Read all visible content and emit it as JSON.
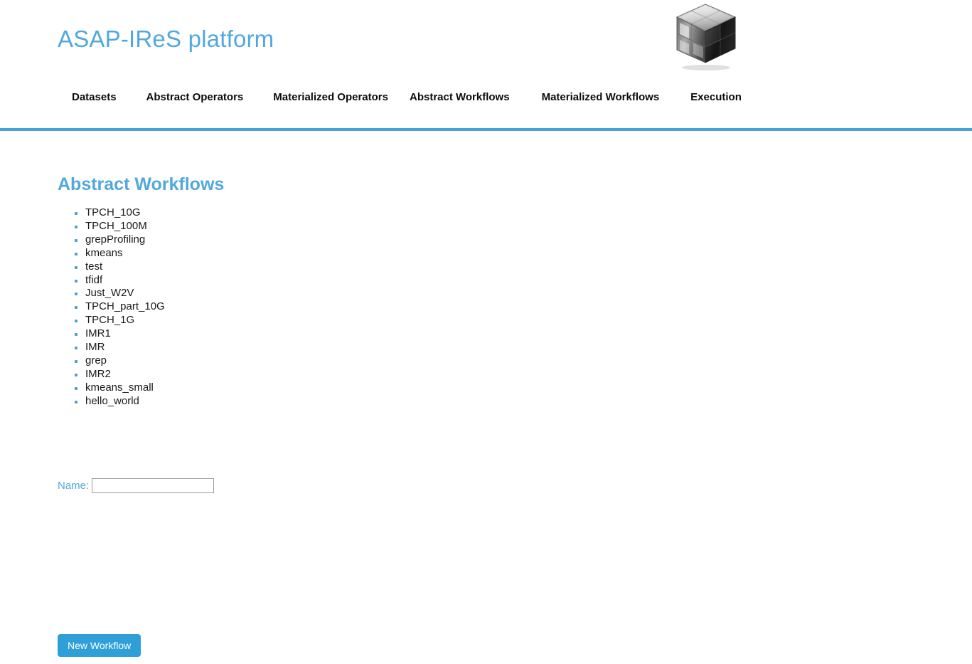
{
  "header": {
    "brand_title": "ASAP-IReS platform",
    "logo_icon": "cube-logo-icon",
    "accent_color": "#52a8dd",
    "rule_color": "#44a3db"
  },
  "nav": {
    "items": [
      {
        "label": "Datasets",
        "name": "nav-item-datasets"
      },
      {
        "label": "Abstract Operators",
        "name": "nav-item-abstract-operators"
      },
      {
        "label": "Materialized Operators",
        "name": "nav-item-materialized-operators"
      },
      {
        "label": "Abstract Workflows",
        "name": "nav-item-abstract-workflows"
      },
      {
        "label": "Materialized Workflows",
        "name": "nav-item-materialized-workflows"
      },
      {
        "label": "Execution",
        "name": "nav-item-execution"
      }
    ]
  },
  "main": {
    "section_title": "Abstract Workflows",
    "workflows": [
      {
        "label": "TPCH_10G"
      },
      {
        "label": "TPCH_100M"
      },
      {
        "label": "grepProfiling"
      },
      {
        "label": "kmeans"
      },
      {
        "label": "test"
      },
      {
        "label": "tfidf"
      },
      {
        "label": "Just_W2V"
      },
      {
        "label": "TPCH_part_10G"
      },
      {
        "label": "TPCH_1G"
      },
      {
        "label": "IMR1"
      },
      {
        "label": "IMR"
      },
      {
        "label": "grep"
      },
      {
        "label": "IMR2"
      },
      {
        "label": "kmeans_small"
      },
      {
        "label": "hello_world"
      }
    ],
    "bullet_color": "#4d9fd4"
  },
  "form": {
    "name_label": "Name:",
    "name_value": "",
    "name_placeholder": "",
    "submit_label": "New Workflow",
    "submit_color": "#2f9fd8"
  }
}
